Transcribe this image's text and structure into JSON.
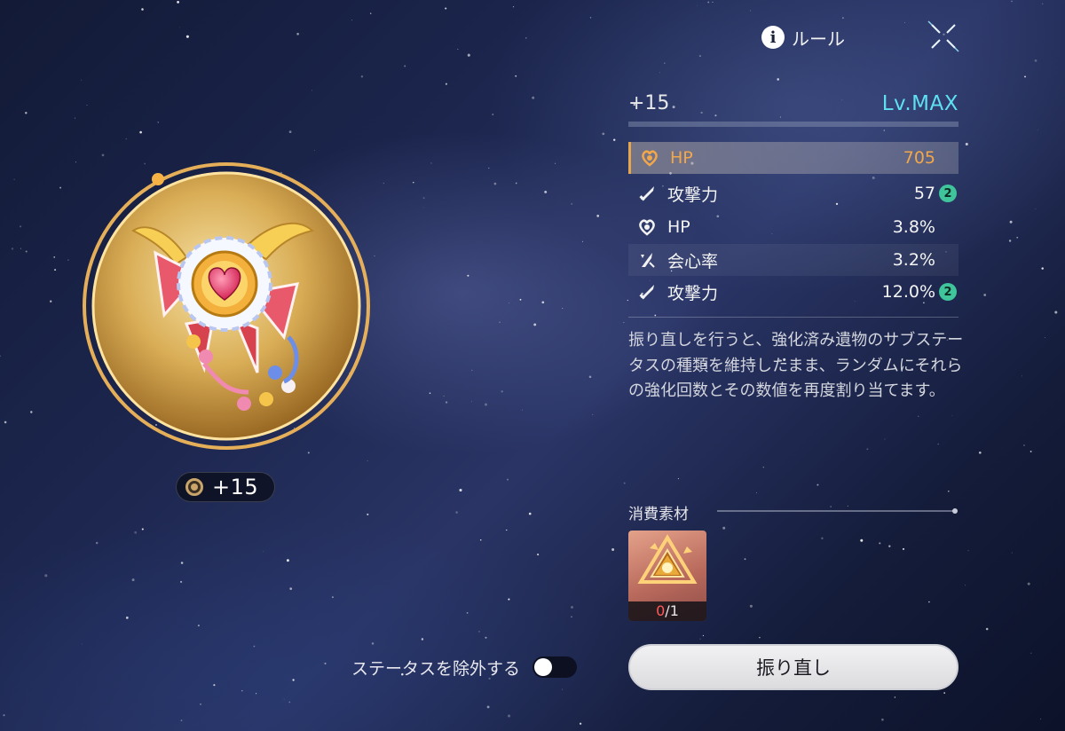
{
  "header": {
    "rule_label": "ルール",
    "rule_icon": "info-icon",
    "close_icon": "close-icon"
  },
  "relic": {
    "name_icon": "heart-brooch-relic-icon",
    "level_badge": "+15",
    "level_badge_icon": "coin-icon"
  },
  "panel": {
    "enhance_level": "+15",
    "level_label": "Lv.MAX",
    "main_stat": {
      "icon": "heart-icon",
      "name": "HP",
      "value": "705"
    },
    "sub_stats": [
      {
        "icon": "sword-icon",
        "name": "攻撃力",
        "value": "57",
        "count": "2"
      },
      {
        "icon": "heart-icon",
        "name": "HP",
        "value": "3.8%",
        "count": ""
      },
      {
        "icon": "crit-rate-icon",
        "name": "会心率",
        "value": "3.2%",
        "count": ""
      },
      {
        "icon": "sword-icon",
        "name": "攻撃力",
        "value": "12.0%",
        "count": "2"
      }
    ],
    "description": "振り直しを行うと、強化済み遺物のサブステータスの種類を維持したまま、ランダムにそれらの強化回数とその数値を再度割り当てます。"
  },
  "materials": {
    "title": "消費素材",
    "items": [
      {
        "icon": "golden-prism-icon",
        "have": "0",
        "need": "/1"
      }
    ]
  },
  "footer": {
    "exclude_label": "ステータスを除外する",
    "toggle_on": false,
    "reroll_label": "振り直し"
  },
  "colors": {
    "accent_orange": "#f3a74b",
    "level_cyan": "#5fe0f2",
    "count_green": "#3fc49b",
    "insufficient_red": "#ff5b5b"
  }
}
